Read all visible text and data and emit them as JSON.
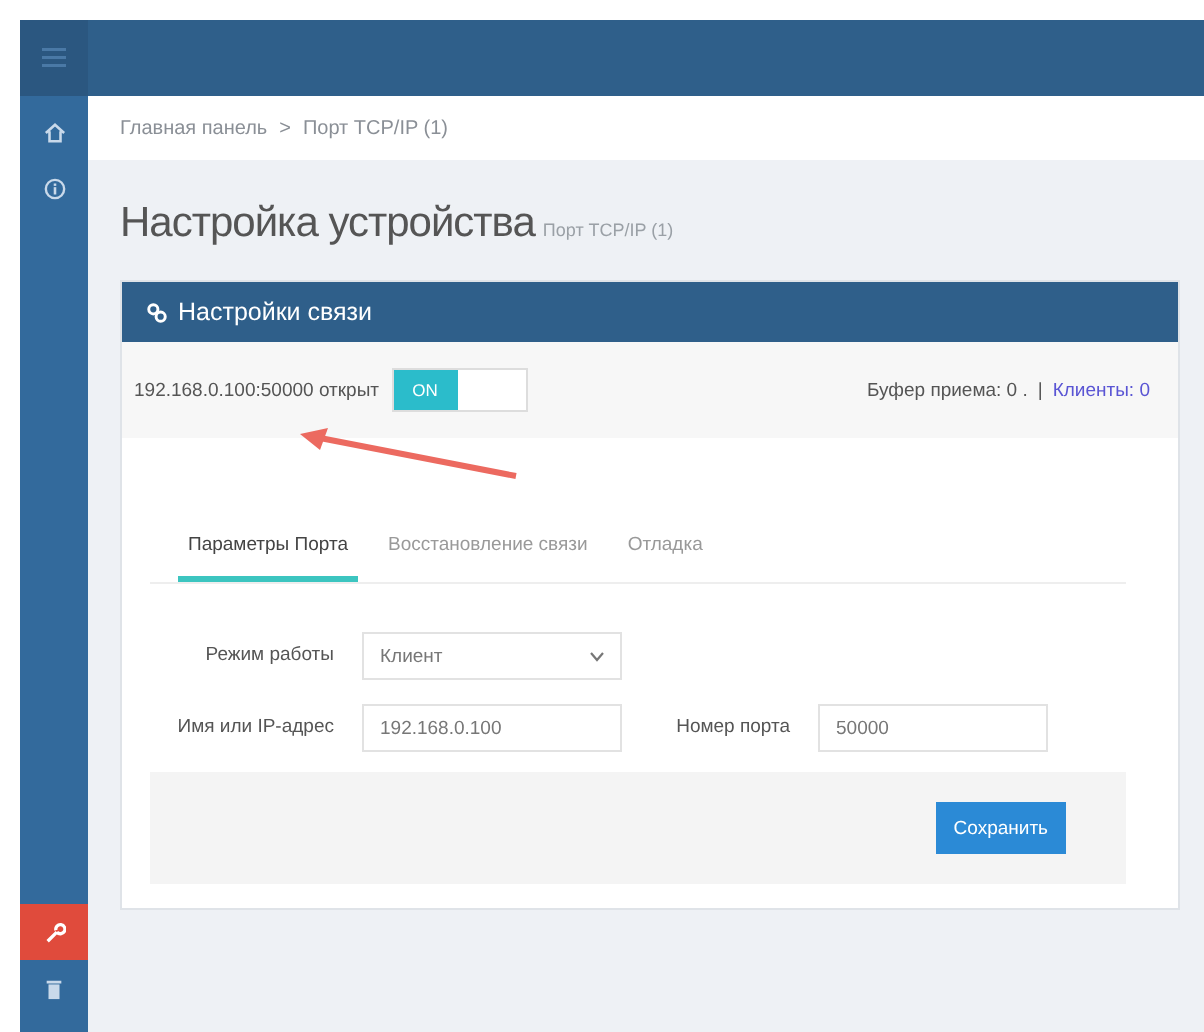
{
  "sidebar": {
    "items": [
      {
        "kind": "home",
        "selected": false
      },
      {
        "kind": "info",
        "selected": false
      },
      {
        "kind": "wrench",
        "selected": true
      },
      {
        "kind": "trash",
        "selected": false
      }
    ]
  },
  "breadcrumb": {
    "items": [
      "Главная панель",
      "Порт TCP/IP (1)"
    ],
    "separator": ">"
  },
  "page_title": "Настройка устройства",
  "page_subtitle": "Порт TCP/IP (1)",
  "panel": {
    "title": "Настройки связи",
    "status": {
      "address": "192.168.0.100:50000 открыт",
      "toggle": {
        "label": "ON",
        "on": true
      },
      "buffer": "Буфер приема: 0 .",
      "separator": "|",
      "clients": "Клиенты: 0"
    },
    "tabs": [
      {
        "label": "Параметры Порта",
        "selected": true
      },
      {
        "label": "Восстановление связи",
        "selected": false
      },
      {
        "label": "Отладка",
        "selected": false
      }
    ],
    "fields": [
      {
        "kind": "select",
        "label": "Режим работы",
        "value": "Клиент"
      },
      {
        "kind": "input",
        "label": "Имя или IP-адрес",
        "value": "192.168.0.100"
      },
      {
        "kind": "input",
        "label": "Номер порта",
        "value": "50000"
      }
    ],
    "save_button": "Сохранить"
  }
}
